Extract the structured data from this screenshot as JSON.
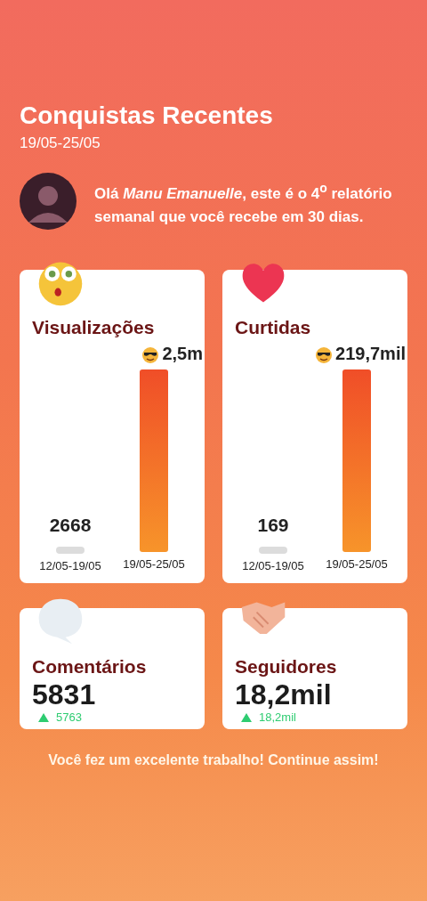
{
  "header": {
    "title": "Conquistas Recentes",
    "date_range": "19/05-25/05"
  },
  "greeting": {
    "text": "Olá *Manu Emanuelle*, este é o **4**$^{o}$ relatório semanal que você recebe em 30 dias."
  },
  "chart_cards": [
    {
      "title": "Visualizações",
      "bars": [
        {
          "kind": "previous",
          "value": "2668",
          "period": "12/05-19/05"
        },
        {
          "kind": "current",
          "value": "2,5m",
          "period": "19/05-25/05"
        }
      ]
    },
    {
      "title": "Curtidas",
      "bars": [
        {
          "kind": "previous",
          "value": "169",
          "period": "12/05-19/05"
        },
        {
          "kind": "current",
          "value": "219,7mil",
          "period": "19/05-25/05"
        }
      ]
    }
  ],
  "stat_cards": [
    {
      "title": "Comentários",
      "value": "5831",
      "change": "5763"
    },
    {
      "title": "Seguidores",
      "value": "18,2mil",
      "change": "18,2mil"
    }
  ],
  "footer": "Você fez um excelente trabalho! Continue assim!"
}
